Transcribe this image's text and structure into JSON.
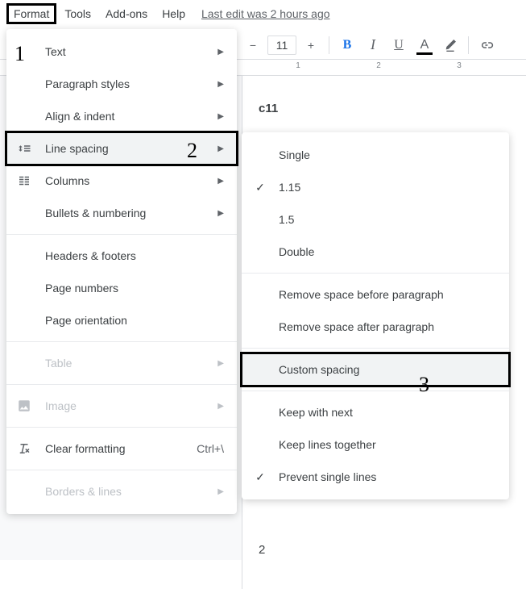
{
  "menubar": {
    "format": "Format",
    "tools": "Tools",
    "addons": "Add-ons",
    "help": "Help",
    "last_edit": "Last edit was 2 hours ago"
  },
  "toolbar": {
    "font_size": "11"
  },
  "ruler": {
    "m1": "1",
    "m2": "2",
    "m3": "3"
  },
  "document": {
    "heading": "c11",
    "para": "2"
  },
  "format_menu": {
    "text": "Text",
    "paragraph_styles": "Paragraph styles",
    "align_indent": "Align & indent",
    "line_spacing": "Line spacing",
    "columns": "Columns",
    "bullets_numbering": "Bullets & numbering",
    "headers_footers": "Headers & footers",
    "page_numbers": "Page numbers",
    "page_orientation": "Page orientation",
    "table": "Table",
    "image": "Image",
    "clear_formatting": "Clear formatting",
    "clear_formatting_shortcut": "Ctrl+\\",
    "borders_lines": "Borders & lines"
  },
  "line_spacing_menu": {
    "single": "Single",
    "v115": "1.15",
    "v15": "1.5",
    "double": "Double",
    "remove_before": "Remove space before paragraph",
    "remove_after": "Remove space after paragraph",
    "custom": "Custom spacing",
    "keep_next": "Keep with next",
    "keep_together": "Keep lines together",
    "prevent_single": "Prevent single lines"
  },
  "steps": {
    "s1": "1",
    "s2": "2",
    "s3": "3"
  }
}
